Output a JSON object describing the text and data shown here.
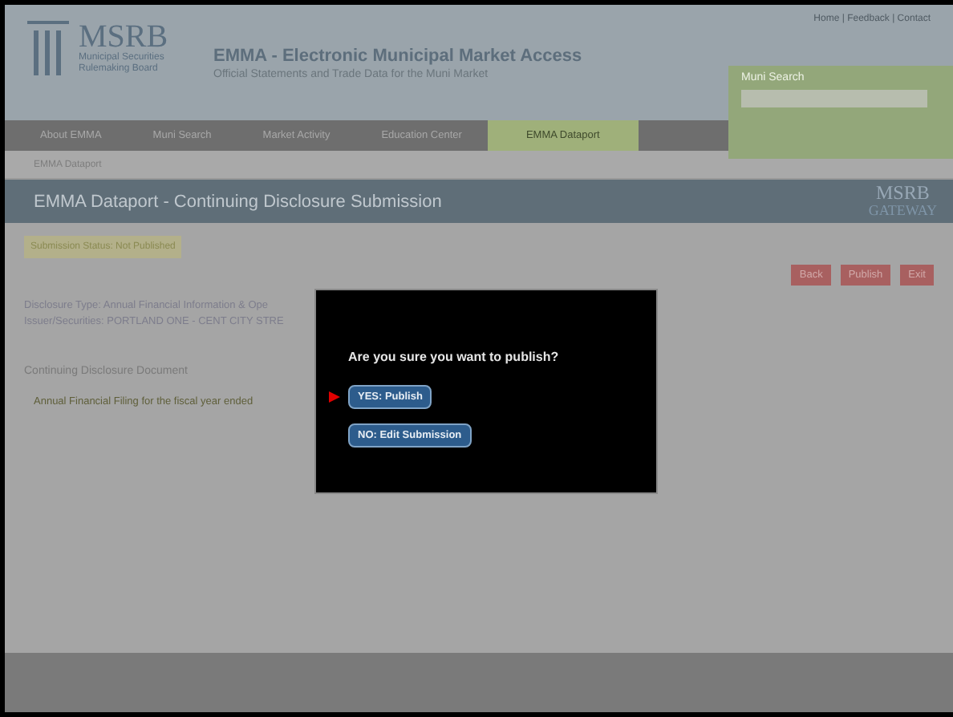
{
  "header": {
    "logo_title": "MSRB",
    "logo_subtitle": "Municipal Securities Rulemaking Board",
    "site_title": "EMMA - Electronic Municipal Market Access",
    "tagline": "Official Statements and Trade Data for the Muni Market",
    "top_links": "Home | Feedback | Contact",
    "search_title": "Muni Search"
  },
  "nav": [
    {
      "label": "About EMMA",
      "selected": false
    },
    {
      "label": "Muni Search",
      "selected": false
    },
    {
      "label": "Market Activity",
      "selected": false
    },
    {
      "label": "Education Center",
      "selected": false
    },
    {
      "label": "EMMA Dataport",
      "selected": true
    }
  ],
  "breadcrumb": "EMMA Dataport",
  "page_title": "EMMA Dataport - Continuing Disclosure Submission",
  "gateway_logo": [
    "MSRB",
    "GATEWAY"
  ],
  "status": "Submission Status: Not Published",
  "actions": [
    "Back",
    "Publish",
    "Exit"
  ],
  "details": [
    "Disclosure Type: Annual Financial Information & Ope",
    "Issuer/Securities: PORTLAND ONE - CENT CITY STRE"
  ],
  "section_title": "Continuing Disclosure Document",
  "document": "Annual Financial Filing for the fiscal year ended",
  "dialog": {
    "question": "Are you sure you want to publish?",
    "options": [
      {
        "label": "YES: Publish",
        "selected": true
      },
      {
        "label": "NO: Edit Submission",
        "selected": false
      }
    ]
  }
}
